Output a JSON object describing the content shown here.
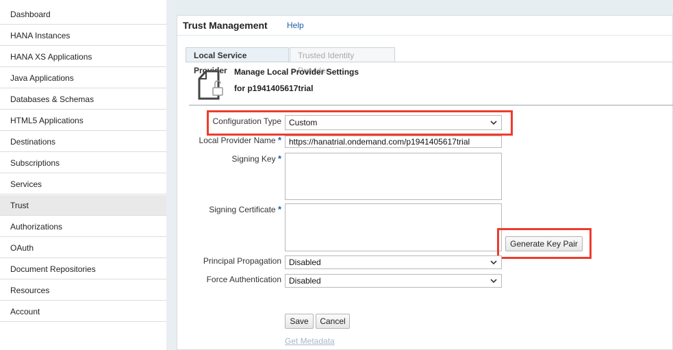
{
  "sidebar": {
    "items": [
      {
        "label": "Dashboard"
      },
      {
        "label": "HANA Instances"
      },
      {
        "label": "HANA XS Applications"
      },
      {
        "label": "Java Applications"
      },
      {
        "label": "Databases & Schemas"
      },
      {
        "label": "HTML5 Applications"
      },
      {
        "label": "Destinations"
      },
      {
        "label": "Subscriptions"
      },
      {
        "label": "Services"
      },
      {
        "label": "Trust"
      },
      {
        "label": "Authorizations"
      },
      {
        "label": "OAuth"
      },
      {
        "label": "Document Repositories"
      },
      {
        "label": "Resources"
      },
      {
        "label": "Account"
      }
    ],
    "active": "Trust"
  },
  "header": {
    "title": "Trust Management",
    "help": "Help"
  },
  "tabs": [
    {
      "label": "Local Service Provider",
      "active": true
    },
    {
      "label": "Trusted Identity Provider",
      "active": false
    }
  ],
  "panel": {
    "title": "Manage Local Provider Settings",
    "subtitle": "for p1941405617trial",
    "icon": "document-unlock-icon"
  },
  "form": {
    "configuration_type": {
      "label": "Configuration Type",
      "value": "Custom"
    },
    "local_provider_name": {
      "label": "Local Provider Name",
      "value": "https://hanatrial.ondemand.com/p1941405617trial",
      "required_mark": "*"
    },
    "signing_key": {
      "label": "Signing Key",
      "value": "",
      "required_mark": "*"
    },
    "signing_certificate": {
      "label": "Signing Certificate",
      "value": "",
      "required_mark": "*"
    },
    "principal_propagation": {
      "label": "Principal Propagation",
      "value": "Disabled"
    },
    "force_authentication": {
      "label": "Force Authentication",
      "value": "Disabled"
    },
    "generate_key_pair": "Generate Key Pair",
    "save": "Save",
    "cancel": "Cancel",
    "get_metadata": "Get Metadata"
  },
  "colors": {
    "highlight": "#ef3b2c",
    "link": "#1a5fa8",
    "required": "#1a5fa8"
  }
}
